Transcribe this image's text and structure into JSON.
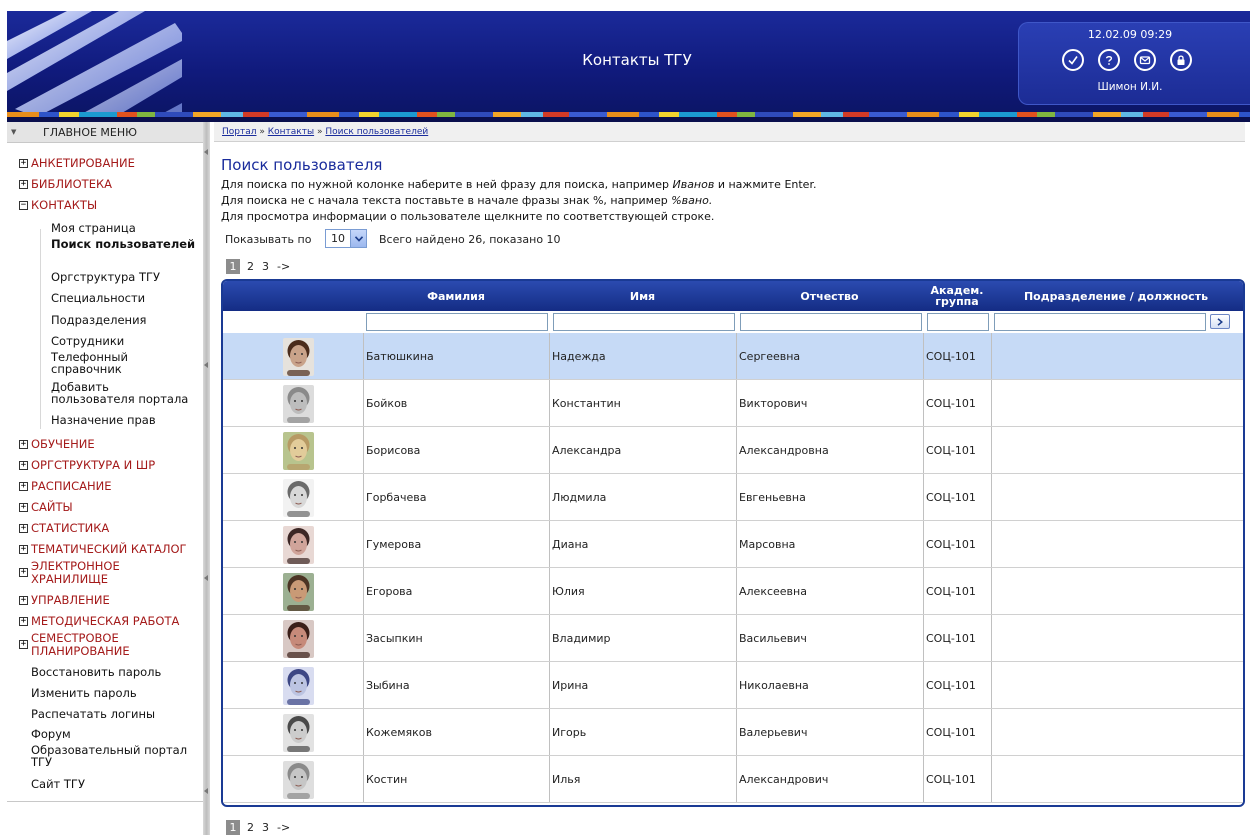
{
  "header": {
    "title": "Контакты ТГУ",
    "datetime": "12.02.09 09:29",
    "username": "Шимон И.И.",
    "icons": [
      "check-icon",
      "help-icon",
      "mail-icon",
      "lock-icon"
    ]
  },
  "sidebar": {
    "menu_title": "ГЛАВНОЕ МЕНЮ",
    "sections": [
      {
        "label": "АНКЕТИРОВАНИЕ",
        "sign": "+"
      },
      {
        "label": "БИБЛИОТЕКА",
        "sign": "+"
      },
      {
        "label": "КОНТАКТЫ",
        "sign": "−"
      },
      {
        "label": "ОБУЧЕНИЕ",
        "sign": "+"
      },
      {
        "label": "ОРГСТРУКТУРА И ШР",
        "sign": "+"
      },
      {
        "label": "РАСПИСАНИЕ",
        "sign": "+"
      },
      {
        "label": "САЙТЫ",
        "sign": "+"
      },
      {
        "label": "СТАТИСТИКА",
        "sign": "+"
      },
      {
        "label": "ТЕМАТИЧЕСКИЙ КАТАЛОГ",
        "sign": "+"
      },
      {
        "label": "ЭЛЕКТРОННОЕ ХРАНИЛИЩЕ",
        "sign": "+"
      },
      {
        "label": "УПРАВЛЕНИЕ",
        "sign": "+"
      },
      {
        "label": "МЕТОДИЧЕСКАЯ РАБОТА",
        "sign": "+"
      },
      {
        "label": "СЕМЕСТРОВОЕ ПЛАНИРОВАНИЕ",
        "sign": "+"
      }
    ],
    "contacts_items": [
      "Моя страница",
      "Поиск пользователей",
      "Оргструктура ТГУ",
      "Специальности",
      "Подразделения",
      "Сотрудники",
      "Телефонный справочник",
      "Добавить пользователя портала",
      "Назначение прав"
    ],
    "tail_items": [
      "Восстановить пароль",
      "Изменить пароль",
      "Распечатать логины",
      "Форум",
      "Образовательный портал ТГУ",
      "Сайт ТГУ"
    ]
  },
  "breadcrumb": {
    "items": [
      "Портал",
      "Контакты",
      "Поиск пользователей"
    ],
    "separator": "»"
  },
  "main": {
    "title": "Поиск пользователя",
    "instr1_pre": "Для поиска по нужной колонке наберите в ней фразу для поиска, например ",
    "instr1_em": "Иванов",
    "instr1_post": " и нажмите Enter.",
    "instr2_pre": "Для поиска не с начала текста поставьте в начале фразы знак %, например ",
    "instr2_em": "%вано.",
    "instr3": "Для просмотра информации о пользователе щелкните по соответствующей строке.",
    "per_page_label": "Показывать по",
    "per_page_value": "10",
    "total_text": "Всего найдено 26, показано 10",
    "pager": {
      "pages": [
        "1",
        "2",
        "3"
      ],
      "current": "1",
      "next": "->"
    }
  },
  "table": {
    "columns": [
      "",
      "Фамилия",
      "Имя",
      "Отчество",
      "Академ. группа",
      "Подразделение / должность"
    ],
    "rows": [
      {
        "last": "Батюшкина",
        "first": "Надежда",
        "middle": "Сергеевна",
        "group": "СОЦ-101",
        "dept": "",
        "selected": true,
        "skin": "#c9a38a",
        "hair": "#4a2c1c",
        "bg": "#e6e2dc"
      },
      {
        "last": "Бойков",
        "first": "Константин",
        "middle": "Викторович",
        "group": "СОЦ-101",
        "dept": "",
        "selected": false,
        "skin": "#bdbdbd",
        "hair": "#8a8a8a",
        "bg": "#dcdcdc"
      },
      {
        "last": "Борисова",
        "first": "Александра",
        "middle": "Александровна",
        "group": "СОЦ-101",
        "dept": "",
        "selected": false,
        "skin": "#e2cc9a",
        "hair": "#b79a64",
        "bg": "#b8c48e"
      },
      {
        "last": "Горбачева",
        "first": "Людмила",
        "middle": "Евгеньевна",
        "group": "СОЦ-101",
        "dept": "",
        "selected": false,
        "skin": "#d8d8d8",
        "hair": "#6a6a6a",
        "bg": "#f2f2f2"
      },
      {
        "last": "Гумерова",
        "first": "Диана",
        "middle": "Марсовна",
        "group": "СОЦ-101",
        "dept": "",
        "selected": false,
        "skin": "#d0a49a",
        "hair": "#3c2624",
        "bg": "#e8d8d4"
      },
      {
        "last": "Егорова",
        "first": "Юлия",
        "middle": "Алексеевна",
        "group": "СОЦ-101",
        "dept": "",
        "selected": false,
        "skin": "#c99a76",
        "hair": "#4c3424",
        "bg": "#9cb092"
      },
      {
        "last": "Засыпкин",
        "first": "Владимир",
        "middle": "Васильевич",
        "group": "СОЦ-101",
        "dept": "",
        "selected": false,
        "skin": "#c68a7a",
        "hair": "#3a1e18",
        "bg": "#d8c8c4"
      },
      {
        "last": "Зыбина",
        "first": "Ирина",
        "middle": "Николаевна",
        "group": "СОЦ-101",
        "dept": "",
        "selected": false,
        "skin": "#bcc4e2",
        "hair": "#3c4684",
        "bg": "#d8dcf0"
      },
      {
        "last": "Кожемяков",
        "first": "Игорь",
        "middle": "Валерьевич",
        "group": "СОЦ-101",
        "dept": "",
        "selected": false,
        "skin": "#cccccc",
        "hair": "#4a4a4a",
        "bg": "#e2e2e2"
      },
      {
        "last": "Костин",
        "first": "Илья",
        "middle": "Александрович",
        "group": "СОЦ-101",
        "dept": "",
        "selected": false,
        "skin": "#c6c6c6",
        "hair": "#8a8a8a",
        "bg": "#dedede"
      }
    ]
  },
  "colors": {
    "header_bg": "#101a7c",
    "accent": "#1a2c9c",
    "menu_section": "#a41a1a",
    "grid_header": "#1a3a94",
    "selected_row": "#c6daf6"
  }
}
